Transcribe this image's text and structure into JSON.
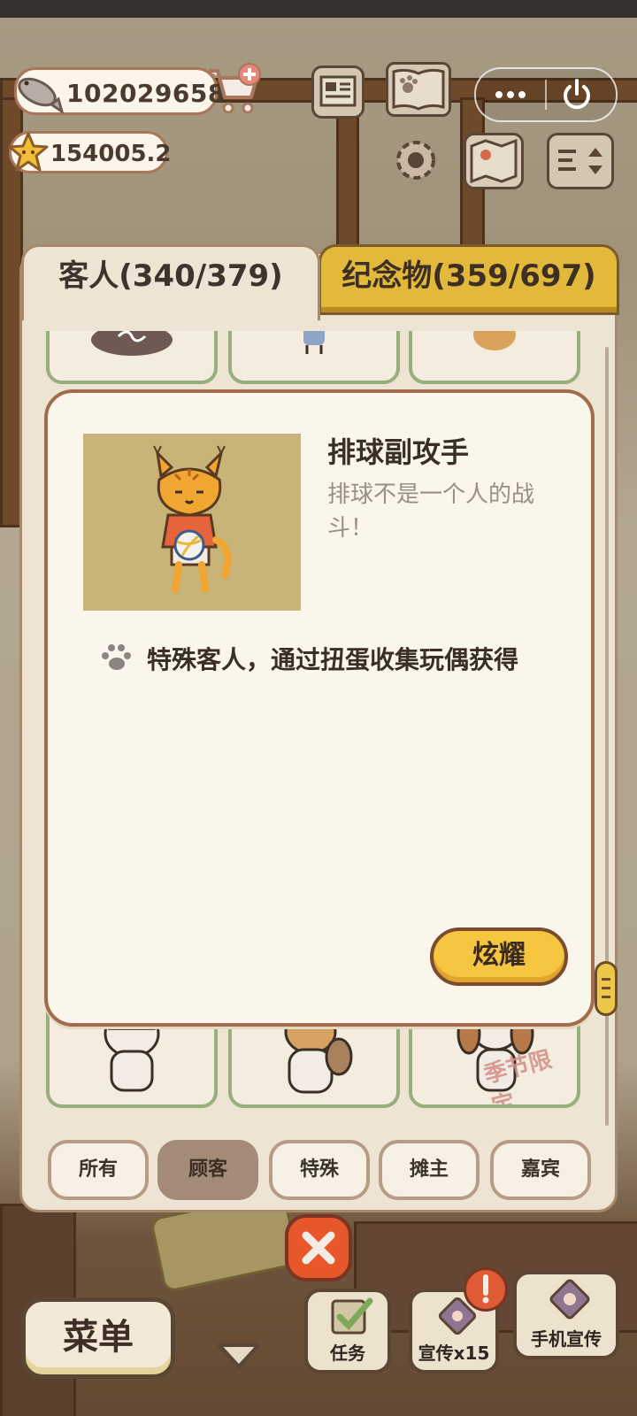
{
  "hud": {
    "fish_count": "102029658",
    "star_count": "154005.2"
  },
  "tabs": {
    "guests": "客人(340/379)",
    "souvenirs": "纪念物(359/697)"
  },
  "detail": {
    "title": "排球副攻手",
    "description": "排球不是一个人的战斗！",
    "source": "特殊客人，通过扭蛋收集玩偶获得",
    "show_button": "炫耀"
  },
  "season_stamp": "季节限定",
  "filters": [
    {
      "label": "所有",
      "active": false
    },
    {
      "label": "顾客",
      "active": true
    },
    {
      "label": "特殊",
      "active": false
    },
    {
      "label": "摊主",
      "active": false
    },
    {
      "label": "嘉宾",
      "active": false
    }
  ],
  "bottom": {
    "menu": "菜单",
    "task": "任务",
    "promo": "宣传x15",
    "phone_promo": "手机宣传"
  },
  "colors": {
    "accent_yellow": "#f6c640",
    "card_border_green": "#98ae7c",
    "close_orange": "#e8572c"
  }
}
